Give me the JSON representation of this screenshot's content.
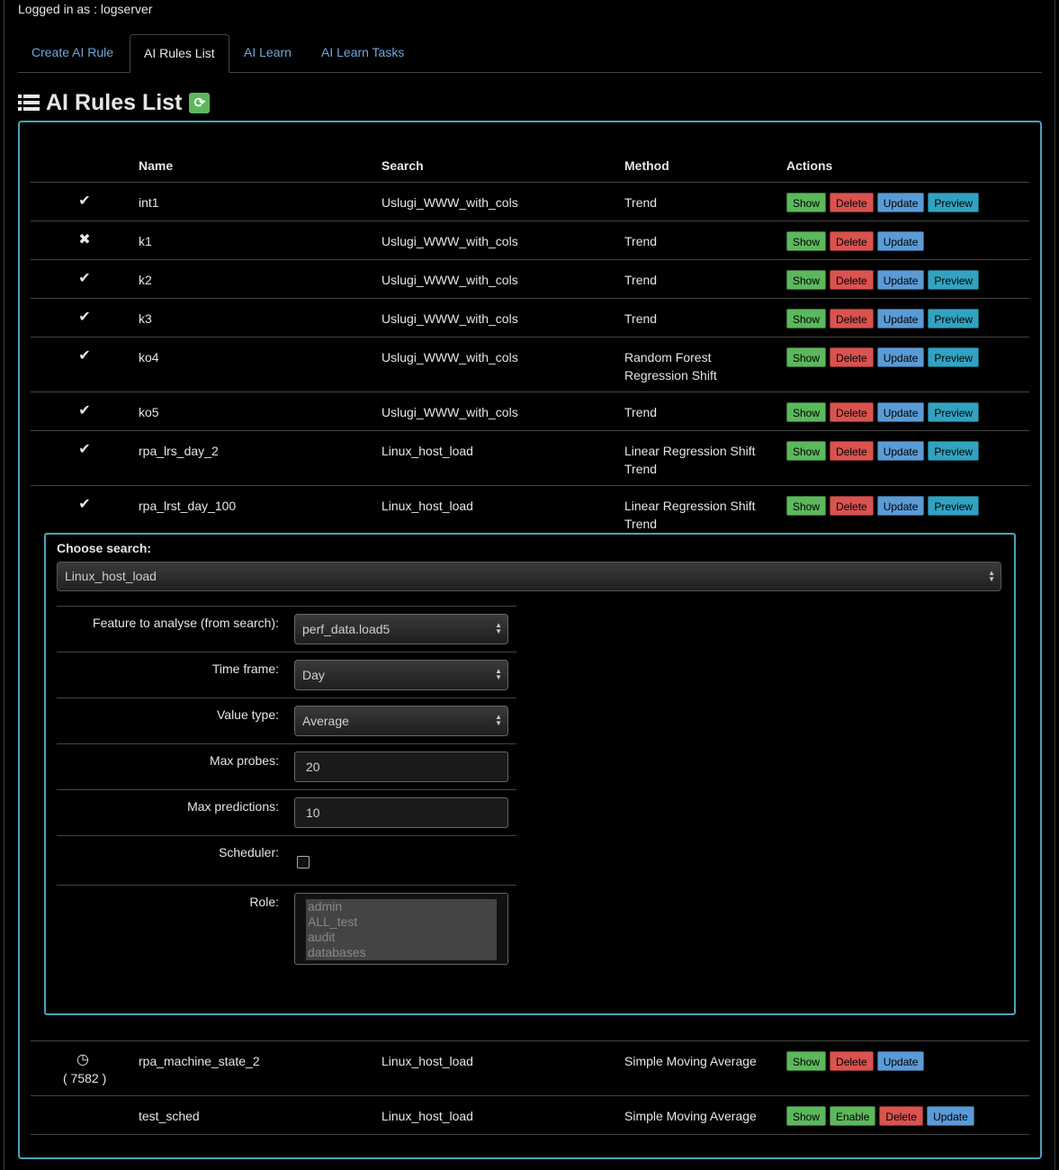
{
  "header": {
    "login_text": "Logged in as : logserver"
  },
  "tabs": [
    {
      "label": "Create AI Rule"
    },
    {
      "label": "AI Rules List"
    },
    {
      "label": "AI Learn"
    },
    {
      "label": "AI Learn Tasks"
    }
  ],
  "page": {
    "title": "AI Rules List",
    "refresh_icon": "refresh-icon"
  },
  "table": {
    "headers": {
      "name": "Name",
      "search": "Search",
      "method": "Method",
      "actions": "Actions"
    },
    "rows": [
      {
        "status": "✔",
        "name": "int1",
        "search": "Uslugi_WWW_with_cols",
        "method": [
          "Trend"
        ],
        "actions": [
          "Show",
          "Delete",
          "Update",
          "Preview"
        ]
      },
      {
        "status": "✖",
        "name": "k1",
        "search": "Uslugi_WWW_with_cols",
        "method": [
          "Trend"
        ],
        "actions": [
          "Show",
          "Delete",
          "Update"
        ]
      },
      {
        "status": "✔",
        "name": "k2",
        "search": "Uslugi_WWW_with_cols",
        "method": [
          "Trend"
        ],
        "actions": [
          "Show",
          "Delete",
          "Update",
          "Preview"
        ]
      },
      {
        "status": "✔",
        "name": "k3",
        "search": "Uslugi_WWW_with_cols",
        "method": [
          "Trend"
        ],
        "actions": [
          "Show",
          "Delete",
          "Update",
          "Preview"
        ]
      },
      {
        "status": "✔",
        "name": "ko4",
        "search": "Uslugi_WWW_with_cols",
        "method": [
          "Random Forest",
          "Regression Shift"
        ],
        "actions": [
          "Show",
          "Delete",
          "Update",
          "Preview"
        ]
      },
      {
        "status": "✔",
        "name": "ko5",
        "search": "Uslugi_WWW_with_cols",
        "method": [
          "Trend"
        ],
        "actions": [
          "Show",
          "Delete",
          "Update",
          "Preview"
        ]
      },
      {
        "status": "✔",
        "name": "rpa_lrs_day_2",
        "search": "Linux_host_load",
        "method": [
          "Linear Regression Shift",
          "Trend"
        ],
        "actions": [
          "Show",
          "Delete",
          "Update",
          "Preview"
        ]
      },
      {
        "status": "✔",
        "name": "rpa_lrst_day_100",
        "search": "Linux_host_load",
        "method": [
          "Linear Regression Shift",
          "Trend"
        ],
        "actions": [
          "Show",
          "Delete",
          "Update",
          "Preview"
        ]
      },
      {
        "status": "◷",
        "status_count": "( 7582 )",
        "name": "rpa_machine_state_2",
        "search": "Linux_host_load",
        "method": [
          "Simple Moving Average"
        ],
        "actions": [
          "Show",
          "Delete",
          "Update"
        ]
      },
      {
        "status": "",
        "name": "test_sched",
        "search": "Linux_host_load",
        "method": [
          "Simple Moving Average"
        ],
        "actions": [
          "Show",
          "Enable",
          "Delete",
          "Update"
        ]
      }
    ]
  },
  "edit_form": {
    "choose_search_label": "Choose search:",
    "choose_search_value": "Linux_host_load",
    "feature_label": "Feature to analyse (from search):",
    "feature_value": "perf_data.load5",
    "timeframe_label": "Time frame:",
    "timeframe_value": "Day",
    "valuetype_label": "Value type:",
    "valuetype_value": "Average",
    "maxprobes_label": "Max probes:",
    "maxprobes_value": "20",
    "maxpred_label": "Max predictions:",
    "maxpred_value": "10",
    "scheduler_label": "Scheduler:",
    "scheduler_checked": false,
    "role_label": "Role:",
    "role_options": [
      "admin",
      "ALL_test",
      "audit",
      "databases"
    ]
  }
}
